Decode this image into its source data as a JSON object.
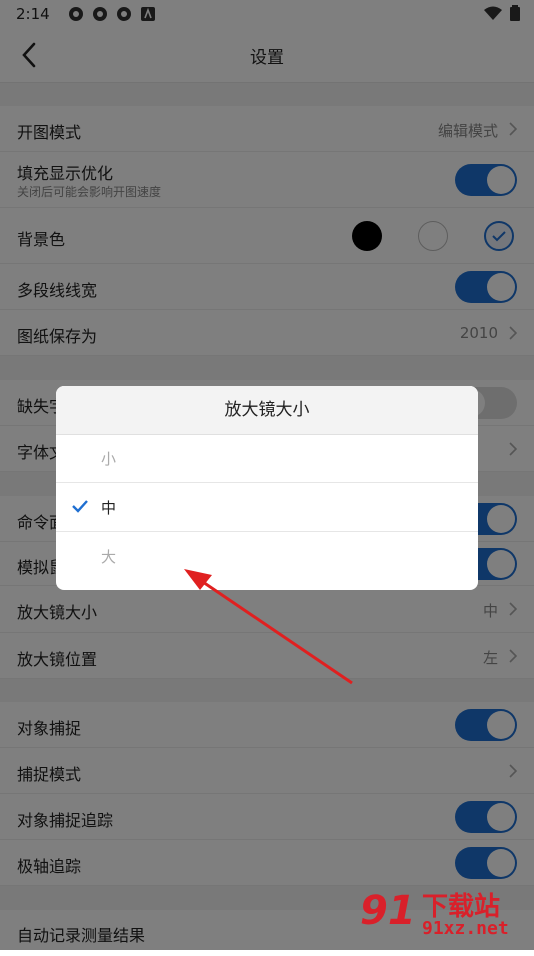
{
  "status_bar": {
    "time": "2:14"
  },
  "header": {
    "title": "设置"
  },
  "settings": {
    "open_mode": {
      "label": "开图模式",
      "value": "编辑模式"
    },
    "fill_opt": {
      "label": "填充显示优化",
      "sub": "关闭后可能会影响开图速度",
      "on": true
    },
    "bg_color": {
      "label": "背景色",
      "options": [
        "#000000",
        "#ffffff",
        "#d0dff5"
      ],
      "selected": 2
    },
    "polyline_width": {
      "label": "多段线线宽",
      "on": true
    },
    "save_as": {
      "label": "图纸保存为",
      "value": "2010"
    },
    "missing_font": {
      "label": "缺失字",
      "on": false
    },
    "font_file": {
      "label": "字体文"
    },
    "command_panel": {
      "label": "命令面",
      "on": true
    },
    "simulate": {
      "label": "模拟鼠",
      "on": true
    },
    "magnifier_size": {
      "label": "放大镜大小",
      "value": "中"
    },
    "magnifier_pos": {
      "label": "放大镜位置",
      "value": "左"
    },
    "object_snap": {
      "label": "对象捕捉",
      "on": true
    },
    "snap_mode": {
      "label": "捕捉模式"
    },
    "snap_tracking": {
      "label": "对象捕捉追踪",
      "on": true
    },
    "polar_tracking": {
      "label": "极轴追踪",
      "on": true
    },
    "auto_record": {
      "label": "自动记录测量结果"
    }
  },
  "dialog": {
    "title": "放大镜大小",
    "options": [
      "小",
      "中",
      "大"
    ],
    "selected_index": 1
  },
  "watermark": {
    "number": "91",
    "text": "下载站",
    "url": "91xz.net"
  },
  "colors": {
    "accent": "#1f6fd1",
    "arrow": "#e02020"
  }
}
